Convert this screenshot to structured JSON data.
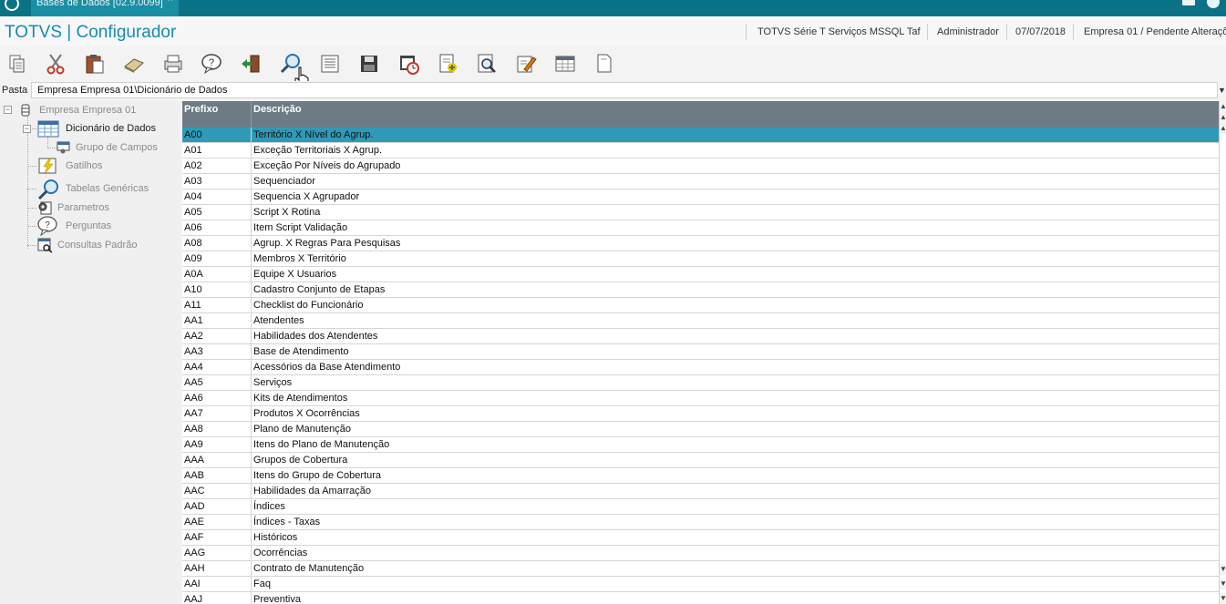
{
  "topbar": {
    "tab_label": "Bases de Dados [02.9.0099]",
    "tab_close": "×"
  },
  "header": {
    "title": "TOTVS | Configurador",
    "environment": "TOTVS Série T Serviços MSSQL Taf",
    "user": "Administrador",
    "date": "07/07/2018",
    "company": "Empresa 01 / Pendente Alteraçõ"
  },
  "toolbar": {
    "buttons": [
      {
        "name": "copy-icon"
      },
      {
        "name": "cut-icon"
      },
      {
        "name": "paste-icon"
      },
      {
        "name": "eraser-icon"
      },
      {
        "name": "print-icon"
      },
      {
        "name": "help-icon"
      },
      {
        "name": "exit-icon"
      },
      {
        "name": "search-icon"
      },
      {
        "name": "list-icon"
      },
      {
        "name": "save-icon"
      },
      {
        "name": "schedule-icon"
      },
      {
        "name": "add-document-icon"
      },
      {
        "name": "preview-icon"
      },
      {
        "name": "edit-icon"
      },
      {
        "name": "table-icon"
      },
      {
        "name": "blank-page-icon"
      }
    ]
  },
  "path": {
    "label": "Pasta",
    "value": "Empresa Empresa 01\\Dicionário de Dados"
  },
  "tree": {
    "root": "Empresa Empresa 01",
    "items": [
      {
        "label": "Dicionário de Dados"
      },
      {
        "label": "Grupo de Campos"
      },
      {
        "label": "Gatilhos"
      },
      {
        "label": "Tabelas Genéricas"
      },
      {
        "label": "Parametros"
      },
      {
        "label": "Perguntas"
      },
      {
        "label": "Consultas Padrão"
      }
    ]
  },
  "grid": {
    "columns": [
      "Prefixo",
      "Descrição"
    ],
    "rows": [
      [
        "A00",
        "Território X Nível do Agrup."
      ],
      [
        "A01",
        "Exceção Territoriais X Agrup."
      ],
      [
        "A02",
        "Exceção Por Níveis do Agrupado"
      ],
      [
        "A03",
        "Sequenciador"
      ],
      [
        "A04",
        "Sequencia X Agrupador"
      ],
      [
        "A05",
        "Script X Rotina"
      ],
      [
        "A06",
        "Item Script Validação"
      ],
      [
        "A08",
        "Agrup. X Regras Para Pesquisas"
      ],
      [
        "A09",
        "Membros X Território"
      ],
      [
        "A0A",
        "Equipe X Usuarios"
      ],
      [
        "A10",
        "Cadastro Conjunto de Etapas"
      ],
      [
        "A11",
        "Checklist do Funcionário"
      ],
      [
        "AA1",
        "Atendentes"
      ],
      [
        "AA2",
        "Habilidades dos Atendentes"
      ],
      [
        "AA3",
        "Base de Atendimento"
      ],
      [
        "AA4",
        "Acessórios da Base Atendimento"
      ],
      [
        "AA5",
        "Serviços"
      ],
      [
        "AA6",
        "Kits de Atendimentos"
      ],
      [
        "AA7",
        "Produtos X Ocorrências"
      ],
      [
        "AA8",
        "Plano de Manutenção"
      ],
      [
        "AA9",
        "Itens do Plano de Manutenção"
      ],
      [
        "AAA",
        "Grupos de Cobertura"
      ],
      [
        "AAB",
        "Itens do Grupo de Cobertura"
      ],
      [
        "AAC",
        "Habilidades da Amarração"
      ],
      [
        "AAD",
        "Índices"
      ],
      [
        "AAE",
        "Índices - Taxas"
      ],
      [
        "AAF",
        "Históricos"
      ],
      [
        "AAG",
        "Ocorrências"
      ],
      [
        "AAH",
        "Contrato de Manutenção"
      ],
      [
        "AAI",
        "Faq"
      ],
      [
        "AAJ",
        "Preventiva"
      ]
    ],
    "selected_index": 0
  },
  "colors": {
    "topbar": "#0b7286",
    "accent": "#1a8ab0",
    "grid_header": "#6d7b85",
    "selected_row": "#2f9ab8"
  }
}
